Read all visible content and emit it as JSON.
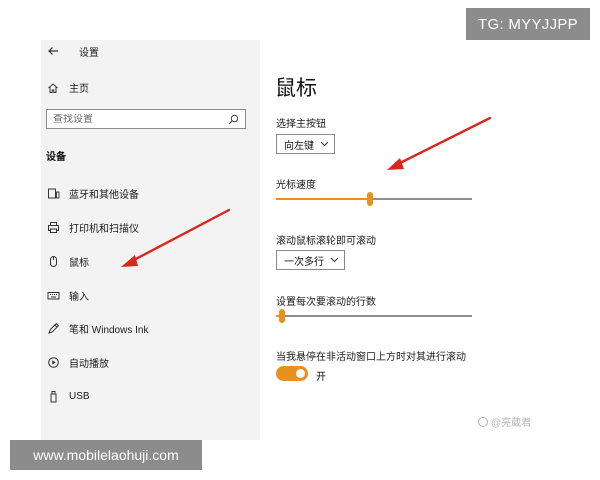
{
  "sidebar": {
    "back_title": "设置",
    "home_label": "主页",
    "search_placeholder": "查找设置",
    "section_title": "设备",
    "items": [
      {
        "label": "蓝牙和其他设备",
        "icon": "bluetooth-devices-icon"
      },
      {
        "label": "打印机和扫描仪",
        "icon": "printer-icon"
      },
      {
        "label": "鼠标",
        "icon": "mouse-icon"
      },
      {
        "label": "输入",
        "icon": "keyboard-icon"
      },
      {
        "label": "笔和 Windows Ink",
        "icon": "pen-icon"
      },
      {
        "label": "自动播放",
        "icon": "autoplay-icon"
      },
      {
        "label": "USB",
        "icon": "usb-icon"
      }
    ]
  },
  "main": {
    "title": "鼠标",
    "primary_button_label": "选择主按钮",
    "primary_button_value": "向左键",
    "cursor_speed_label": "光标速度",
    "cursor_speed_fraction": 0.48,
    "wheel_scroll_label": "滚动鼠标滚轮即可滚动",
    "wheel_scroll_value": "一次多行",
    "lines_label": "设置每次要滚动的行数",
    "lines_fraction": 0.03,
    "inactive_scroll_label": "当我悬停在非活动窗口上方时对其进行滚动",
    "inactive_scroll_state": "开",
    "inactive_scroll_on": true
  },
  "overlays": {
    "tg_text": "TG: MYYJJPP",
    "site_text": "www.mobilelaohuji.com",
    "watermark_text": "@亮葳君"
  },
  "colors": {
    "accent": "#e8911e",
    "arrow": "#d9271d",
    "sidebar_bg": "#f3f3f3",
    "badge_bg": "#8c8c8c"
  }
}
